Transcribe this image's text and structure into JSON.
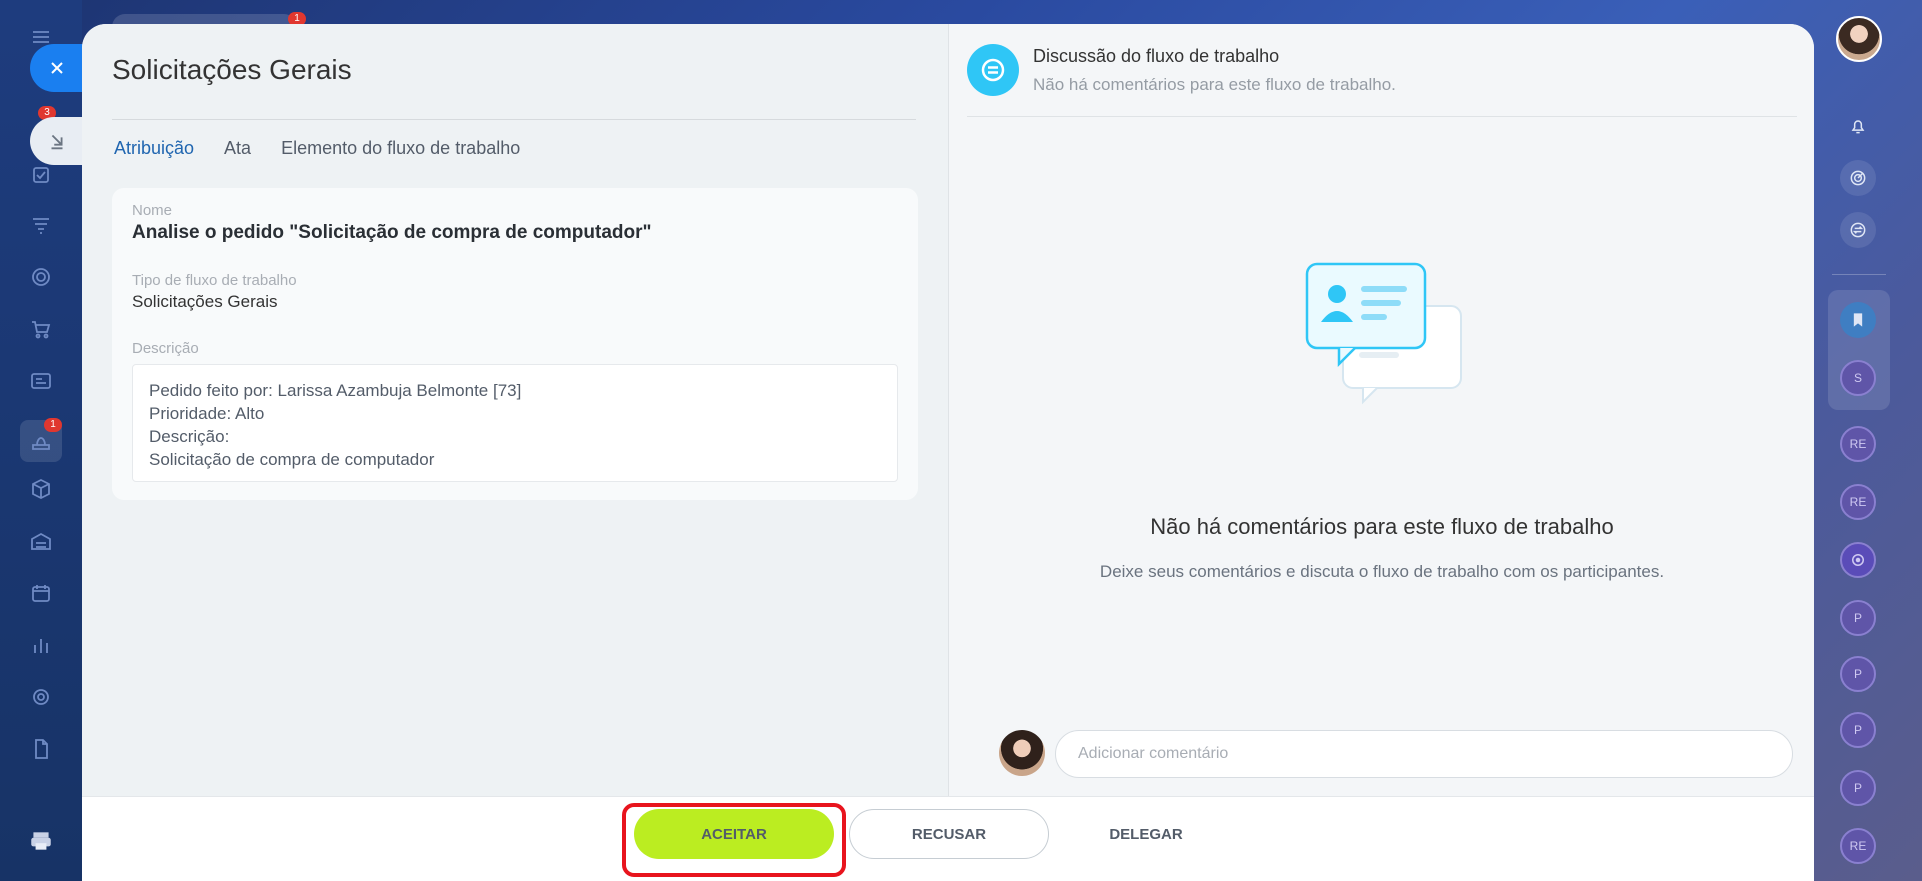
{
  "left_sidebar": {
    "badges": [
      "3",
      "1"
    ],
    "top_badge": "1"
  },
  "header": {
    "title": "Solicitações Gerais"
  },
  "tabs": [
    {
      "label": "Atribuição",
      "active": true
    },
    {
      "label": "Ata",
      "active": false
    },
    {
      "label": "Elemento do fluxo de trabalho",
      "active": false
    }
  ],
  "details": {
    "name_label": "Nome",
    "name_value": "Analise o pedido \"Solicitação de compra de computador\"",
    "type_label": "Tipo de fluxo de trabalho",
    "type_value": "Solicitações Gerais",
    "description_label": "Descrição",
    "description_lines": [
      "Pedido feito por: Larissa Azambuja Belmonte [73]",
      "Prioridade: Alto",
      "Descrição:",
      "Solicitação de compra de computador"
    ]
  },
  "discussion": {
    "title": "Discussão do fluxo de trabalho",
    "subtitle": "Não há comentários para este fluxo de trabalho.",
    "empty_title": "Não há comentários para este fluxo de trabalho",
    "empty_subtitle": "Deixe seus comentários e discuta o fluxo de trabalho com os participantes.",
    "comment_placeholder": "Adicionar comentário"
  },
  "actions": {
    "accept": "ACEITAR",
    "decline": "RECUSAR",
    "delegate": "DELEGAR"
  },
  "right_sidebar": {
    "circles": [
      "S",
      "RE",
      "RE",
      "P",
      "P",
      "P",
      "P",
      "RE"
    ]
  },
  "colors": {
    "accept": "#bbed21",
    "accent_blue": "#2066b0",
    "highlight_red": "#e8141d",
    "discussion_icon": "#2fc6f6"
  }
}
